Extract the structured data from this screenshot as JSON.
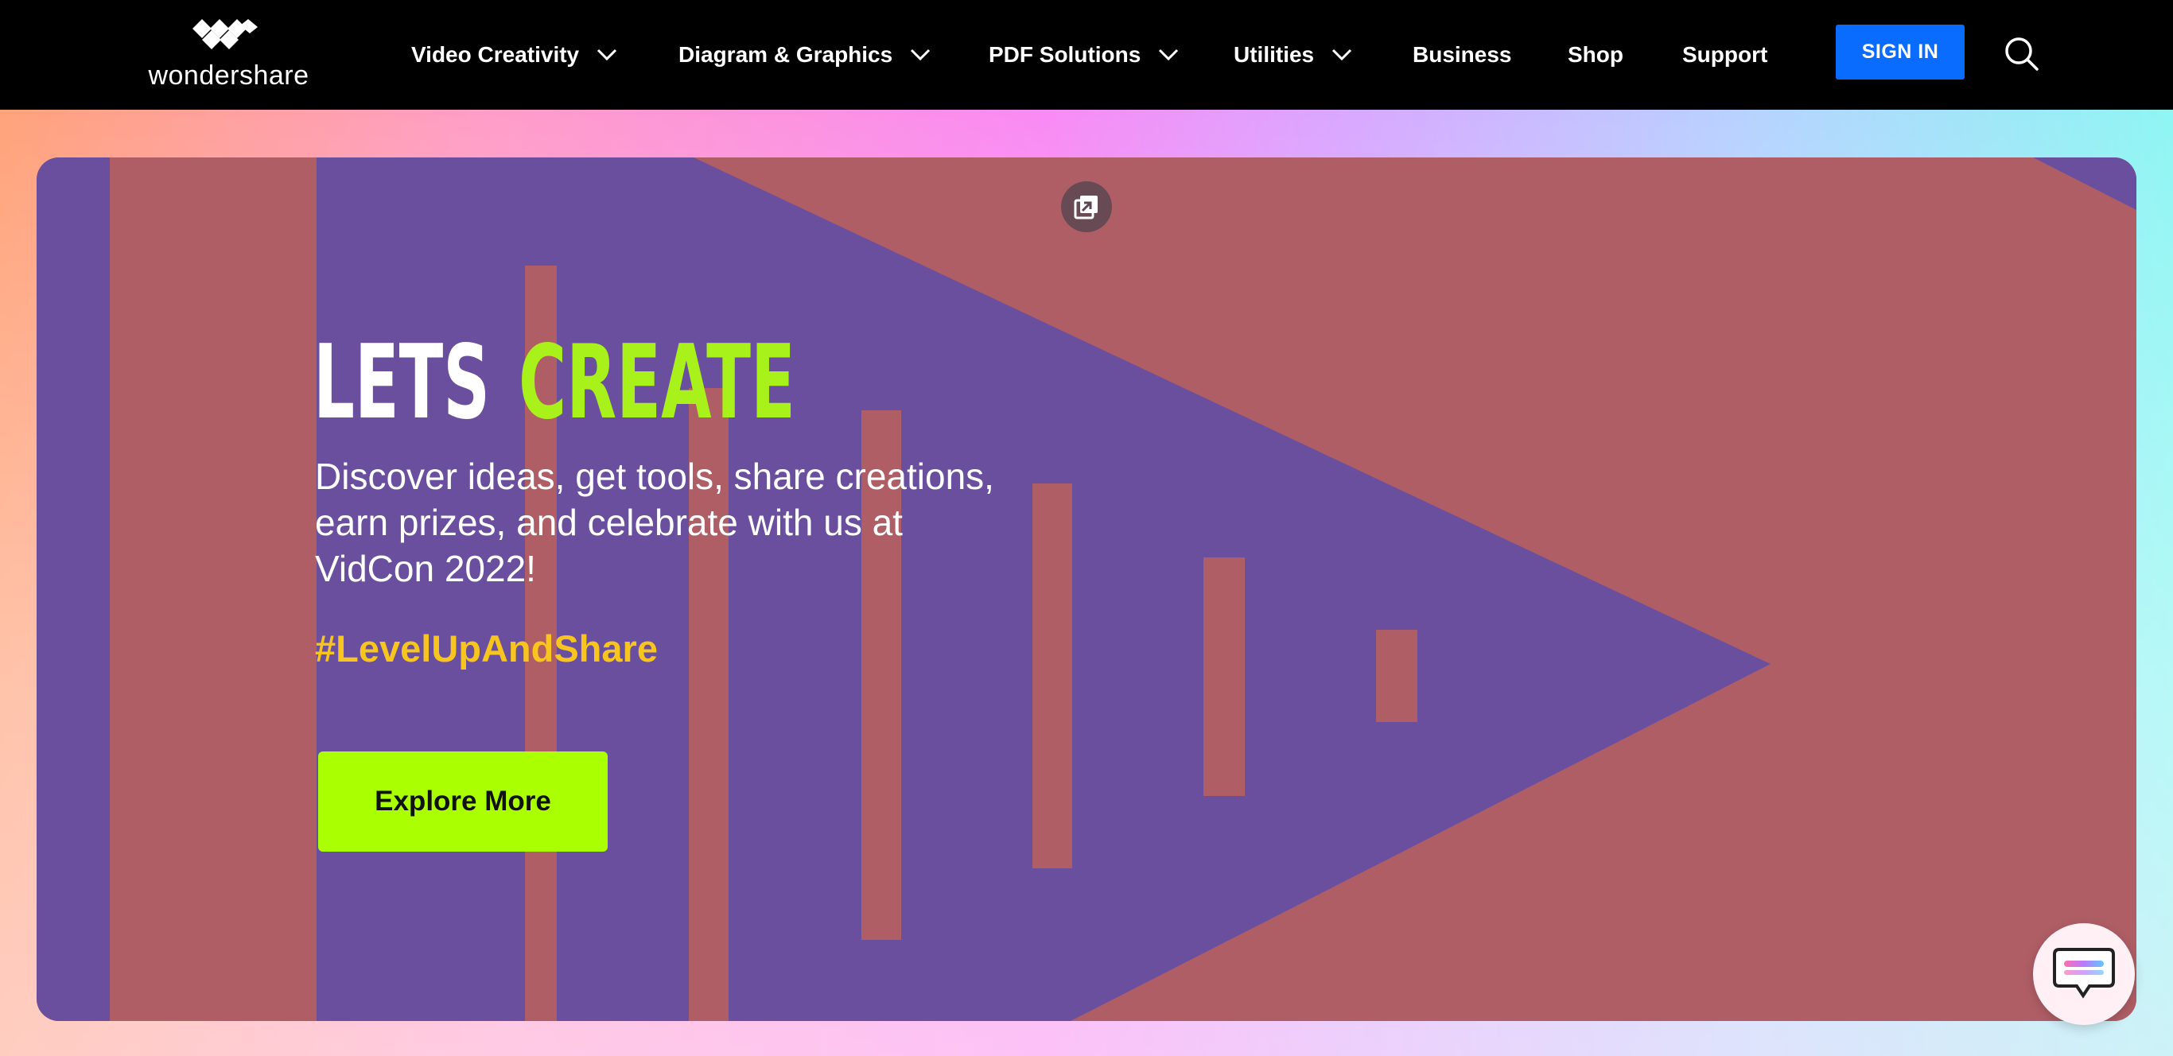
{
  "header": {
    "brand": "wondershare",
    "nav": [
      {
        "label": "Video Creativity",
        "dropdown": true
      },
      {
        "label": "Diagram & Graphics",
        "dropdown": true
      },
      {
        "label": "PDF Solutions",
        "dropdown": true
      },
      {
        "label": "Utilities",
        "dropdown": true
      },
      {
        "label": "Business",
        "dropdown": false
      },
      {
        "label": "Shop",
        "dropdown": false
      },
      {
        "label": "Support",
        "dropdown": false
      }
    ],
    "sign_in_label": "SIGN IN",
    "search_icon": "search-icon"
  },
  "hero": {
    "headline_part1": "LETS",
    "headline_part2": "CREATE",
    "description": "Discover ideas, get tools, share creations, earn prizes, and celebrate with us at VidCon 2022!",
    "hashtag": "#LevelUpAndShare",
    "cta_label": "Explore More",
    "popout_icon": "picture-in-picture-icon"
  },
  "chat_widget": {
    "icon": "chat-icon"
  },
  "colors": {
    "header_bg": "#000000",
    "sign_in": "#0a6cff",
    "hero_red": "#b05e66",
    "hero_purple": "#6a4f9e",
    "cta": "#aaff00",
    "hashtag": "#f7c51e",
    "headline_green": "#a8f11a"
  }
}
